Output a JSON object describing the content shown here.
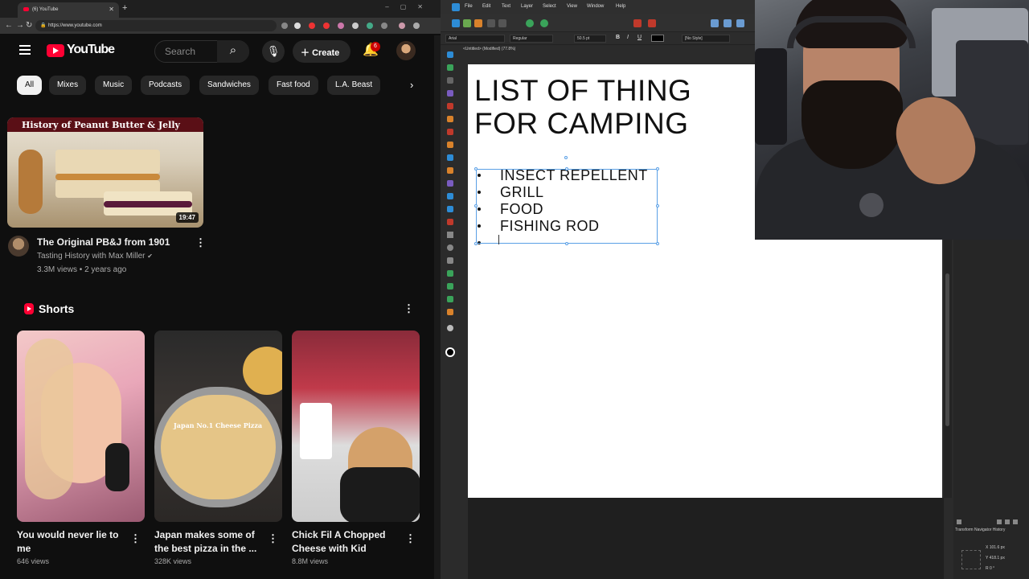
{
  "browser": {
    "tab_title": "(6) YouTube",
    "url": "https://www.youtube.com",
    "notification_count": "6",
    "search_placeholder": "Search",
    "create_label": "Create",
    "logo_text": "YouTube"
  },
  "chips": [
    "All",
    "Mixes",
    "Music",
    "Podcasts",
    "Sandwiches",
    "Fast food",
    "L.A. Beast"
  ],
  "featured_video": {
    "thumbnail_banner": "History of Peanut Butter & Jelly",
    "duration": "19:47",
    "title": "The Original PB&J from 1901",
    "channel": "Tasting History with Max Miller",
    "meta": "3.3M views • 2 years ago"
  },
  "shorts": {
    "section_label": "Shorts",
    "items": [
      {
        "title": "You would never lie to me",
        "views": "646 views"
      },
      {
        "title": "Japan makes some of the best pizza in the ...",
        "views": "328K views",
        "overlay": "Japan No.1 Cheese Pizza"
      },
      {
        "title": "Chick Fil A Chopped Cheese with Kid",
        "views": "8.8M views"
      }
    ]
  },
  "app": {
    "menu": [
      "File",
      "Edit",
      "Text",
      "Layer",
      "Select",
      "View",
      "Window",
      "Help"
    ],
    "font_family": "Arial",
    "font_style": "Regular",
    "font_size": "50.5 pt",
    "paragraph_style": "[No Style]",
    "document_tab": "<Untitled> (Modified) (77.8%)",
    "doc_title_line1": "LIST OF THING",
    "doc_title_line2": "FOR CAMPING",
    "list_items": [
      "INSECT REPELLENT",
      "GRILL",
      "FOOD",
      "FISHING ROD"
    ],
    "panel_tabs": "Transform   Navigator   History",
    "transform_w": "101.6 px",
    "transform_h": "418.1 px",
    "transform_r": "0 °"
  }
}
